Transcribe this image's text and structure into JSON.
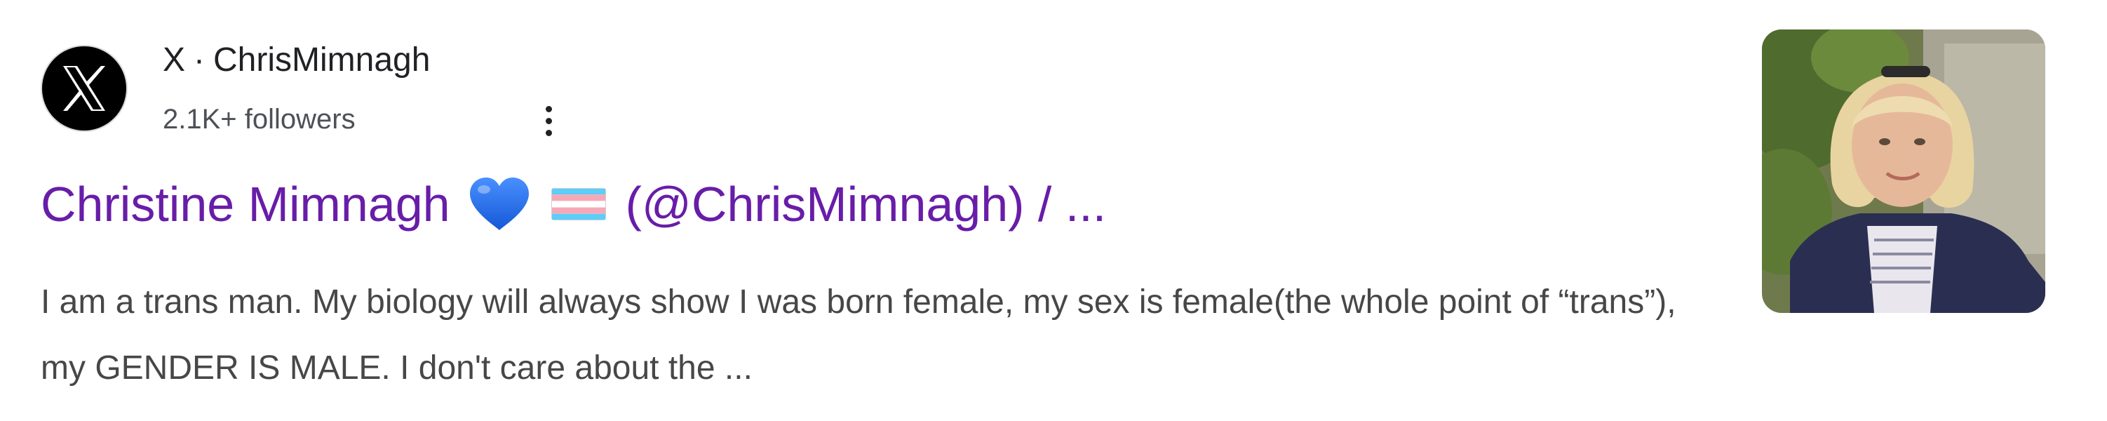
{
  "source": {
    "site_name": "X",
    "separator": "·",
    "account": "ChrisMimnagh",
    "followers": "2.1K+ followers",
    "logo_icon": "x-logo-icon",
    "menu_icon": "more-vert-icon"
  },
  "result": {
    "title_name": "Christine Mimnagh",
    "title_rest": "(@ChrisMimnagh) / ...",
    "title_icons": [
      "blue-heart-icon",
      "transgender-flag-icon"
    ],
    "snippet": "I am a trans man. My biology will always show I was born female, my sex is female(the whole point of “trans”), my GENDER IS MALE. I don't care about the ...",
    "thumbnail": "profile-photo"
  },
  "colors": {
    "title_link": "#681da8",
    "snippet_text": "#474747",
    "heart": "#1a73e8",
    "flag_blue": "#5bcefa",
    "flag_pink": "#f5a9b8"
  }
}
